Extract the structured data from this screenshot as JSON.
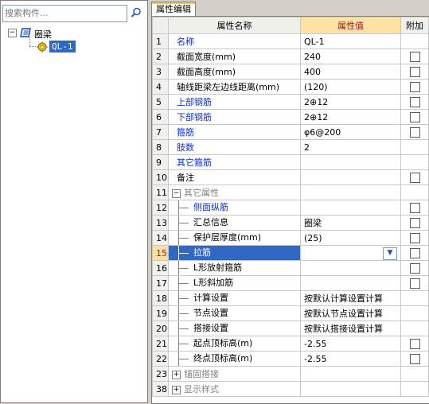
{
  "search": {
    "placeholder": "搜索构件..."
  },
  "tree": {
    "root_label": "圈梁",
    "child_label": "QL-1",
    "root_expander": "−"
  },
  "tab": {
    "label": "属性编辑"
  },
  "grid": {
    "headers": {
      "name": "属性名称",
      "value": "属性值",
      "extra": "附加"
    },
    "rows": [
      {
        "num": "1",
        "name": "名称",
        "value": "QL-1",
        "checkbox": false,
        "style": "blue"
      },
      {
        "num": "2",
        "name": "截面宽度(mm)",
        "value": "240",
        "checkbox": true,
        "style": "normal"
      },
      {
        "num": "3",
        "name": "截面高度(mm)",
        "value": "400",
        "checkbox": true,
        "style": "normal"
      },
      {
        "num": "4",
        "name": "轴线距梁左边线距离(mm)",
        "value": "(120)",
        "checkbox": true,
        "style": "normal"
      },
      {
        "num": "5",
        "name": "上部钢筋",
        "value": "2⊕12",
        "checkbox": true,
        "style": "blue"
      },
      {
        "num": "6",
        "name": "下部钢筋",
        "value": "2⊕12",
        "checkbox": true,
        "style": "blue"
      },
      {
        "num": "7",
        "name": "箍筋",
        "value": "φ6@200",
        "checkbox": true,
        "style": "blue"
      },
      {
        "num": "8",
        "name": "肢数",
        "value": "2",
        "checkbox": false,
        "style": "blue"
      },
      {
        "num": "9",
        "name": "其它箍筋",
        "value": "",
        "checkbox": false,
        "style": "blue"
      },
      {
        "num": "10",
        "name": "备注",
        "value": "",
        "checkbox": true,
        "style": "normal"
      },
      {
        "num": "11",
        "name": "其它属性",
        "value": "",
        "checkbox": false,
        "style": "group",
        "expander": "−"
      },
      {
        "num": "12",
        "name": "侧面纵筋",
        "value": "",
        "checkbox": true,
        "style": "child-blue"
      },
      {
        "num": "13",
        "name": "汇总信息",
        "value": "圈梁",
        "checkbox": true,
        "style": "child"
      },
      {
        "num": "14",
        "name": "保护层厚度(mm)",
        "value": "(25)",
        "checkbox": true,
        "style": "child"
      },
      {
        "num": "15",
        "name": "拉筋",
        "value": "",
        "checkbox": true,
        "style": "child-selected"
      },
      {
        "num": "16",
        "name": "L形放射箍筋",
        "value": "",
        "checkbox": true,
        "style": "child"
      },
      {
        "num": "17",
        "name": "L形斜加筋",
        "value": "",
        "checkbox": true,
        "style": "child"
      },
      {
        "num": "18",
        "name": "计算设置",
        "value": "按默认计算设置计算",
        "checkbox": false,
        "style": "child"
      },
      {
        "num": "19",
        "name": "节点设置",
        "value": "按默认节点设置计算",
        "checkbox": false,
        "style": "child"
      },
      {
        "num": "20",
        "name": "搭接设置",
        "value": "按默认搭接设置计算",
        "checkbox": false,
        "style": "child"
      },
      {
        "num": "21",
        "name": "起点顶标高(m)",
        "value": "-2.55",
        "checkbox": true,
        "style": "child"
      },
      {
        "num": "22",
        "name": "终点顶标高(m)",
        "value": "-2.55",
        "checkbox": true,
        "style": "child"
      },
      {
        "num": "23",
        "name": "锚固搭接",
        "value": "",
        "checkbox": false,
        "style": "group",
        "expander": "+"
      },
      {
        "num": "38",
        "name": "显示样式",
        "value": "",
        "checkbox": false,
        "style": "group",
        "expander": "+"
      }
    ]
  },
  "colors": {
    "selection": "#3168c4",
    "link_blue": "#1030c8",
    "header_highlight": "#fde2a4"
  }
}
